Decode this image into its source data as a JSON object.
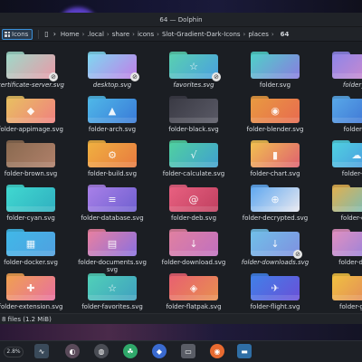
{
  "window": {
    "title": "64 — Dolphin"
  },
  "toolbar": {
    "view_label": "Icons",
    "breadcrumbs": [
      "Home",
      ".local",
      "share",
      "icons",
      "Slot-Gradient-Dark-Icons",
      "places"
    ],
    "current_dir": "64"
  },
  "files": [
    {
      "name": "certificate-server.svg",
      "italic": true,
      "c1": "#9fd8c8",
      "c2": "#e99aa8",
      "glyph": "",
      "link": true
    },
    {
      "name": "desktop.svg",
      "italic": true,
      "c1": "#7fd7f0",
      "c2": "#c27ee8",
      "glyph": "",
      "link": true,
      "selected": false
    },
    {
      "name": "favorites.svg",
      "italic": true,
      "c1": "#59d0b0",
      "c2": "#4aa0e0",
      "glyph": "☆",
      "link": true
    },
    {
      "name": "folder.svg",
      "italic": false,
      "c1": "#4fd0c8",
      "c2": "#8a7ce0",
      "glyph": ""
    },
    {
      "name": "folder_bl",
      "italic": true,
      "c1": "#8e86e8",
      "c2": "#d889c8",
      "glyph": ""
    },
    {
      "name": "folder-appimage.svg",
      "italic": false,
      "c1": "#e8c060",
      "c2": "#f08080",
      "glyph": "◆"
    },
    {
      "name": "folder-arch.svg",
      "italic": false,
      "c1": "#4fb8e8",
      "c2": "#3a7ad8",
      "glyph": "▲"
    },
    {
      "name": "folder-black.svg",
      "italic": false,
      "c1": "#3a3a44",
      "c2": "#5a5a66",
      "glyph": ""
    },
    {
      "name": "folder-blender.svg",
      "italic": false,
      "c1": "#e89a40",
      "c2": "#e86a50",
      "glyph": "◉"
    },
    {
      "name": "folder-bl",
      "italic": false,
      "c1": "#58a8e8",
      "c2": "#3a6ad0",
      "glyph": ""
    },
    {
      "name": "folder-brown.svg",
      "italic": false,
      "c1": "#8a6a50",
      "c2": "#b0806a",
      "glyph": ""
    },
    {
      "name": "folder-build.svg",
      "italic": false,
      "c1": "#f0b040",
      "c2": "#e87a40",
      "glyph": "⚙"
    },
    {
      "name": "folder-calculate.svg",
      "italic": false,
      "c1": "#50d0a0",
      "c2": "#40a0d0",
      "glyph": "√"
    },
    {
      "name": "folder-chart.svg",
      "italic": false,
      "c1": "#f0c050",
      "c2": "#e06070",
      "glyph": "▮"
    },
    {
      "name": "folder-clo",
      "italic": false,
      "c1": "#4fd0e0",
      "c2": "#4a90e0",
      "glyph": "☁"
    },
    {
      "name": "folder-cyan.svg",
      "italic": false,
      "c1": "#40d8d0",
      "c2": "#30b0c0",
      "glyph": ""
    },
    {
      "name": "folder-database.svg",
      "italic": false,
      "c1": "#a880e8",
      "c2": "#7060d0",
      "glyph": "≡"
    },
    {
      "name": "folder-deb.svg",
      "italic": false,
      "c1": "#e86080",
      "c2": "#c04060",
      "glyph": "@"
    },
    {
      "name": "folder-decrypted.svg",
      "italic": false,
      "c1": "#60a8f0",
      "c2": "#e8e8f0",
      "glyph": "⊕"
    },
    {
      "name": "folder-des",
      "italic": false,
      "c1": "#e0b050",
      "c2": "#60c0d0",
      "glyph": ""
    },
    {
      "name": "folder-docker.svg",
      "italic": false,
      "c1": "#40b8e8",
      "c2": "#50a0e0",
      "glyph": "▦"
    },
    {
      "name": "folder-documents.svg",
      "italic": false,
      "c1": "#e880a0",
      "c2": "#8a70e0",
      "glyph": "▤"
    },
    {
      "name": "folder-download.svg",
      "italic": false,
      "c1": "#e080a0",
      "c2": "#c070c0",
      "glyph": "↓"
    },
    {
      "name": "folder-downloads.svg",
      "italic": true,
      "c1": "#70c0e8",
      "c2": "#8090e0",
      "glyph": "↓",
      "link": true
    },
    {
      "name": "folder-draw",
      "italic": false,
      "c1": "#e090c0",
      "c2": "#8a80e0",
      "glyph": ""
    },
    {
      "name": "folder-extension.svg",
      "italic": false,
      "c1": "#f0a050",
      "c2": "#e870a0",
      "glyph": "✚"
    },
    {
      "name": "folder-favorites.svg",
      "italic": false,
      "c1": "#50d0b8",
      "c2": "#40a0c0",
      "glyph": "☆"
    },
    {
      "name": "folder-flatpak.svg",
      "italic": false,
      "c1": "#e86070",
      "c2": "#e89050",
      "glyph": "◈"
    },
    {
      "name": "folder-flight.svg",
      "italic": false,
      "c1": "#4080e8",
      "c2": "#6a50d8",
      "glyph": "✈"
    },
    {
      "name": "folder-gam",
      "italic": false,
      "c1": "#f0c040",
      "c2": "#e08060",
      "glyph": ""
    }
  ],
  "second_line": {
    "21": "svg"
  },
  "status": {
    "text": "8 files (1.2 MiB)"
  },
  "taskbar": {
    "battery_text": "2.8%"
  }
}
